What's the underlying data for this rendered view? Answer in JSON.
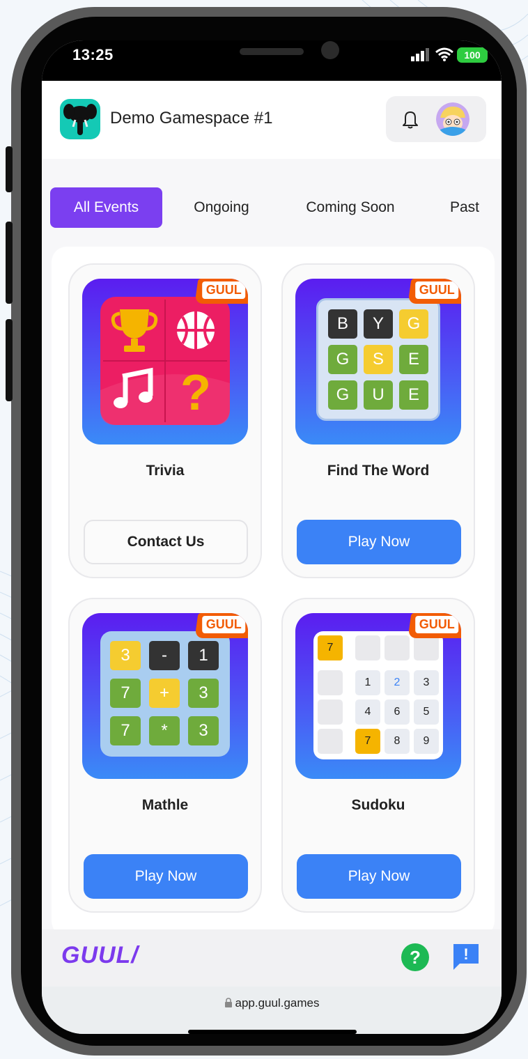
{
  "status_bar": {
    "time": "13:25",
    "battery": "100"
  },
  "header": {
    "gamespace_name": "Demo Gamespace #1"
  },
  "tabs": [
    {
      "label": "All Events",
      "active": true
    },
    {
      "label": "Ongoing",
      "active": false
    },
    {
      "label": "Coming Soon",
      "active": false
    },
    {
      "label": "Past",
      "active": false
    }
  ],
  "games": [
    {
      "title": "Trivia",
      "badge": "GUUL",
      "button": "Contact Us",
      "button_style": "outline",
      "icons": [
        "trophy-icon",
        "basketball-icon",
        "music-notes-icon",
        "question-mark-icon"
      ],
      "tile_color": "#ec1e63"
    },
    {
      "title": "Find The Word",
      "badge": "GUUL",
      "button": "Play Now",
      "button_style": "primary",
      "letters": [
        "B",
        "Y",
        "G",
        "G",
        "S",
        "E",
        "G",
        "U",
        "E"
      ]
    },
    {
      "title": "Mathle",
      "badge": "GUUL",
      "button": "Play Now",
      "button_style": "primary",
      "tiles": [
        "3",
        "-",
        "1",
        "7",
        "+",
        "3",
        "7",
        "*",
        "3"
      ]
    },
    {
      "title": "Sudoku",
      "badge": "GUUL",
      "button": "Play Now",
      "button_style": "primary",
      "corner": "7",
      "grid": [
        "1",
        "2",
        "3",
        "4",
        "6",
        "5",
        "7",
        "8",
        "9"
      ]
    }
  ],
  "footer": {
    "brand": "GUUL/",
    "help_symbol": "?",
    "feedback_symbol": "!"
  },
  "browser": {
    "url": "app.guul.games"
  },
  "colors": {
    "accent_purple": "#7b3ff0",
    "primary_blue": "#3b82f6",
    "badge_orange": "#f25c05",
    "help_green": "#1db954"
  }
}
